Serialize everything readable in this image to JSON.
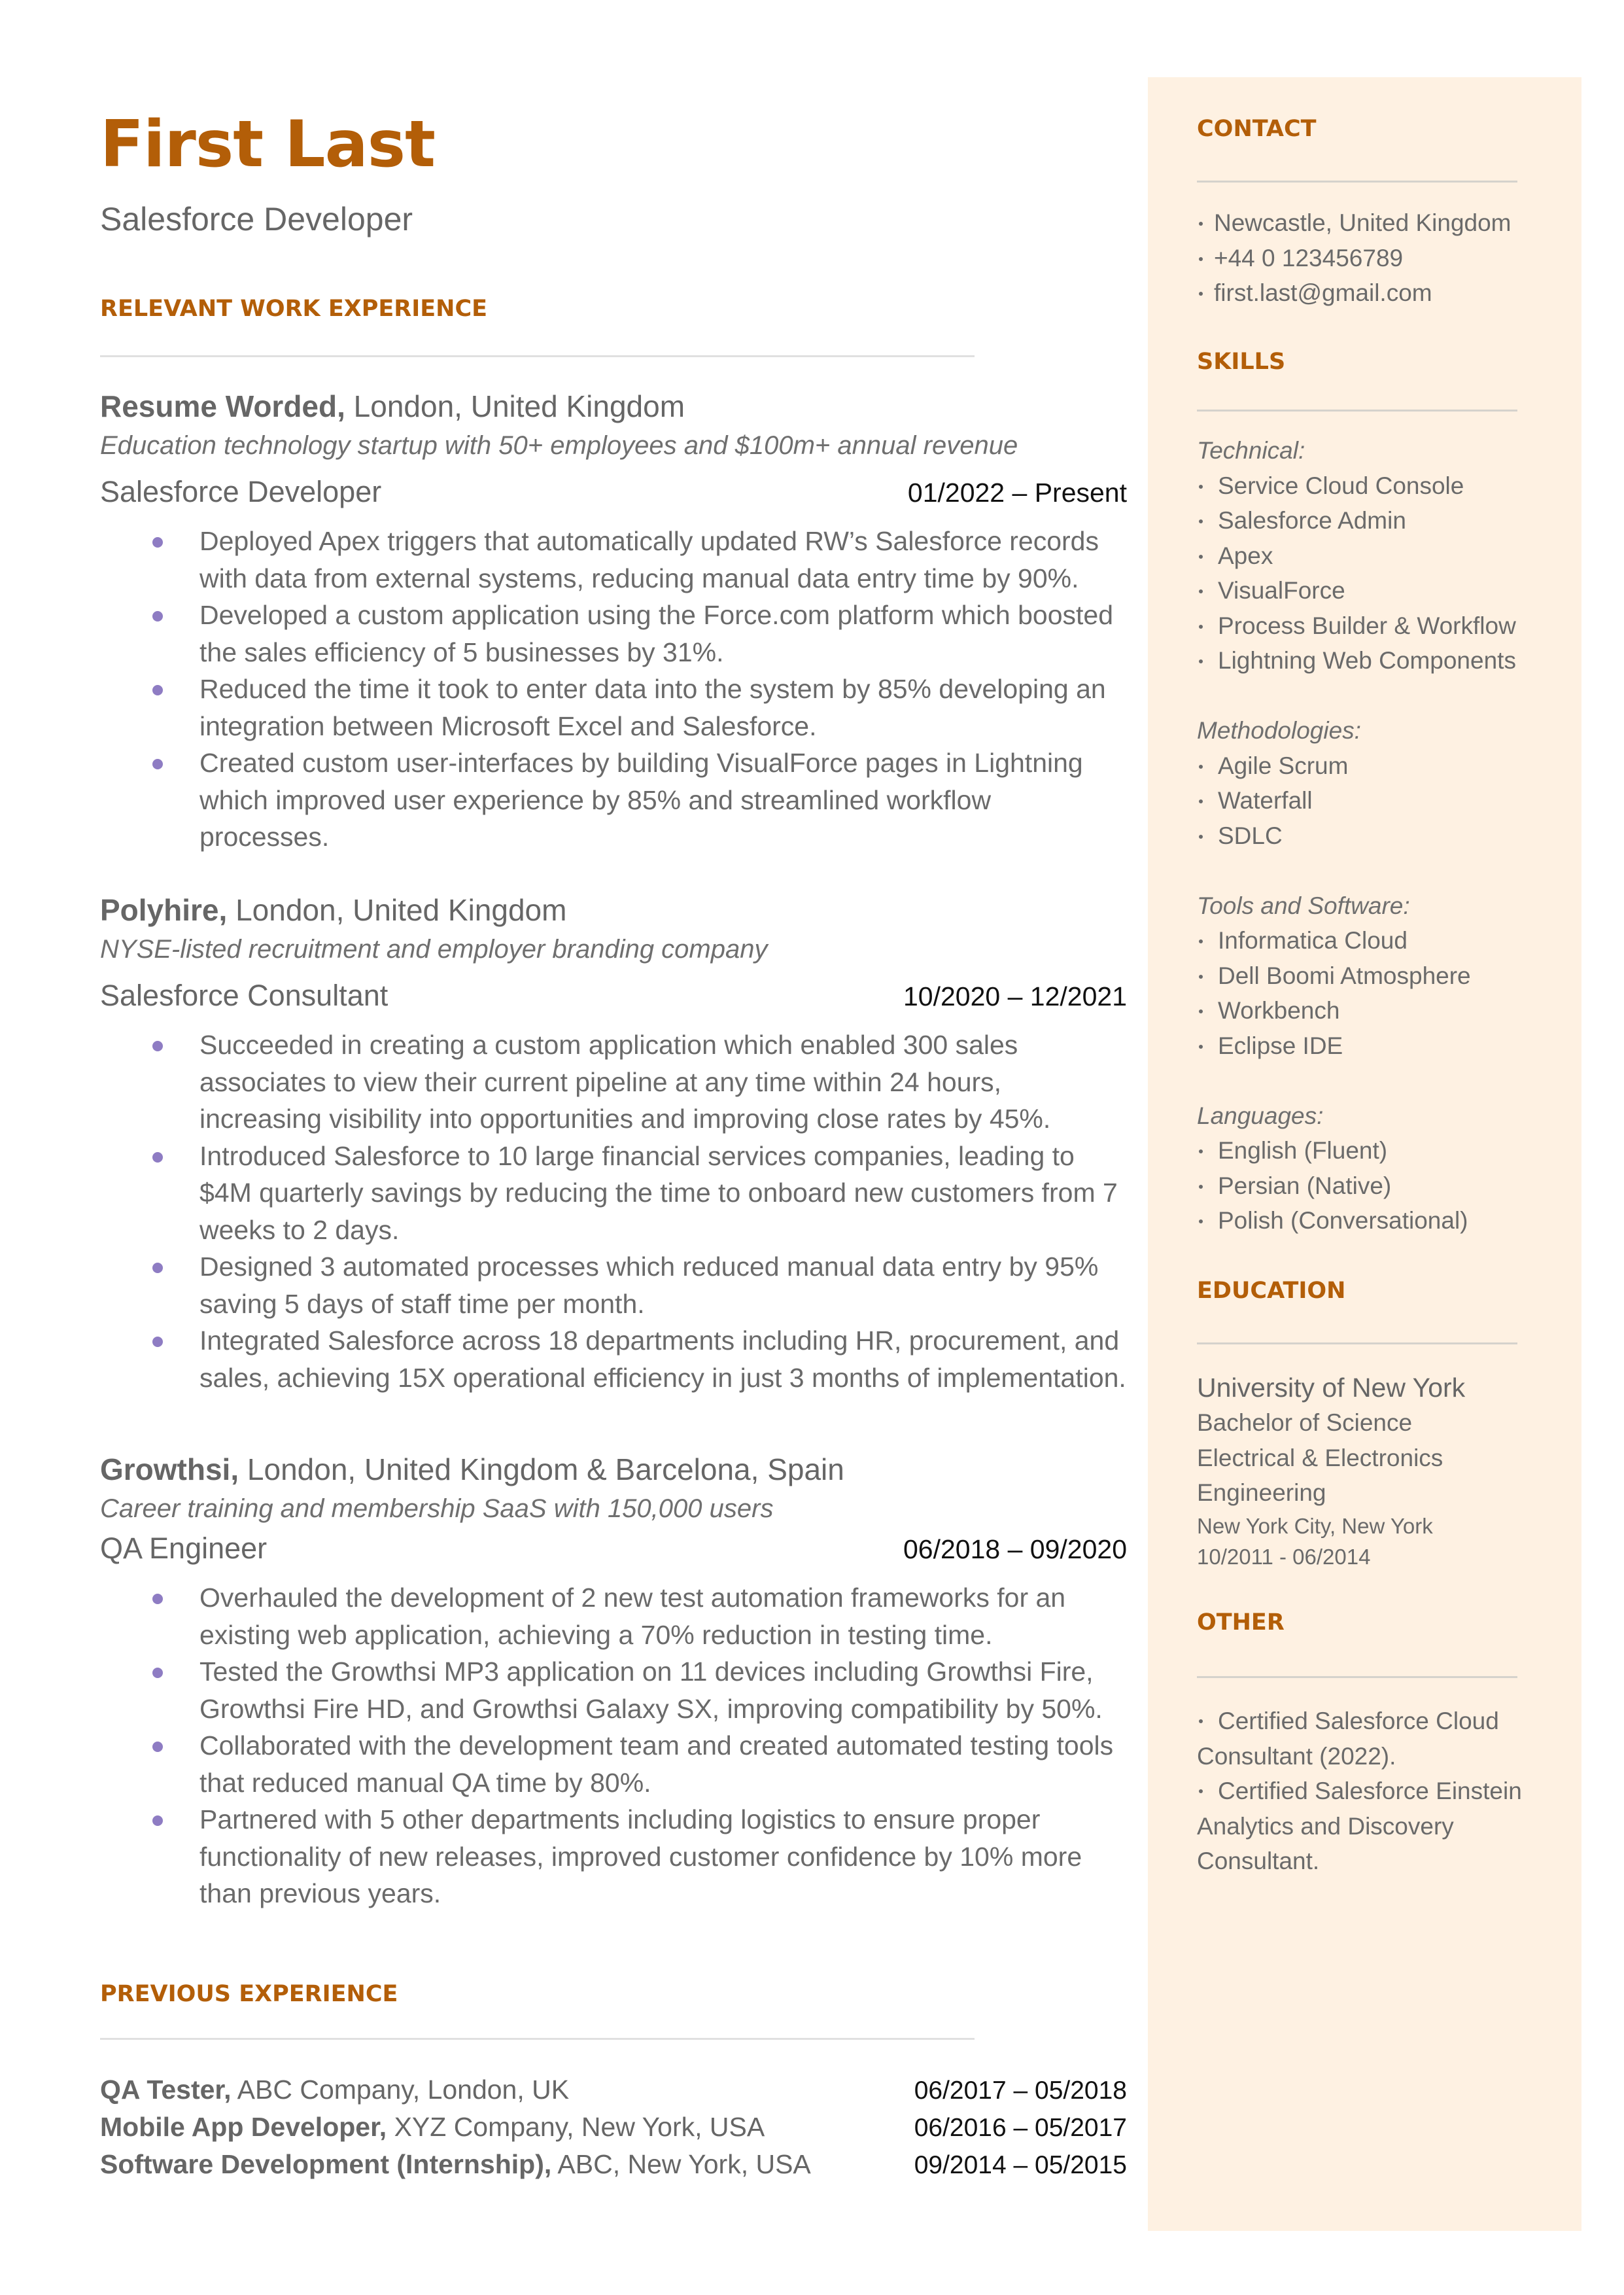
{
  "header": {
    "name": "First Last",
    "title": "Salesforce Developer"
  },
  "colors": {
    "accent": "#b35e08",
    "sidebar_bg": "#fef1e2",
    "bullet": "#8e7cc3",
    "text": "#666666",
    "dates": "#111111"
  },
  "work": {
    "heading": "RELEVANT WORK EXPERIENCE",
    "jobs": [
      {
        "company": "Resume Worded,",
        "location": " London, United Kingdom",
        "description": "Education technology startup with 50+ employees and $100m+ annual revenue",
        "role": "Salesforce Developer",
        "dates": "01/2022 – Present",
        "bullets": [
          "Deployed Apex triggers that automatically updated RW’s Salesforce records with data from external systems, reducing manual data entry time by 90%.",
          "Developed a custom application using the Force.com platform which boosted the sales efficiency of 5 businesses by 31%.",
          "Reduced the time it took to enter data into the system by 85% developing an integration between Microsoft Excel and Salesforce.",
          "Created custom user-interfaces by building VisualForce pages in Lightning which improved user experience by 85% and streamlined workflow processes."
        ]
      },
      {
        "company": "Polyhire,",
        "location": " London, United Kingdom",
        "description": "NYSE-listed recruitment and employer branding company",
        "role": "Salesforce Consultant",
        "dates": "10/2020 – 12/2021",
        "bullets": [
          "Succeeded in creating a custom application which enabled 300 sales associates to view their current pipeline at any time within 24 hours, increasing visibility into opportunities and improving close rates by 45%.",
          "Introduced Salesforce to 10 large financial services companies, leading to $4M quarterly savings by reducing the time to onboard new customers from 7 weeks to 2 days.",
          "Designed 3 automated processes which reduced manual data entry by 95% saving 5 days of staff time per month.",
          "Integrated Salesforce across 18 departments including HR, procurement, and sales, achieving 15X operational efficiency in just 3 months of implementation."
        ]
      },
      {
        "company": "Growthsi,",
        "location": " London, United Kingdom & Barcelona, Spain",
        "description": "Career training and membership SaaS with 150,000 users",
        "role": "QA Engineer",
        "dates": "06/2018 – 09/2020",
        "bullets": [
          "Overhauled the development of 2 new test automation frameworks for an existing web application, achieving a 70% reduction in testing time.",
          "Tested the Growthsi MP3 application on 11 devices including Growthsi Fire, Growthsi Fire HD, and Growthsi Galaxy SX, improving compatibility by 50%.",
          "Collaborated with the development team and created automated testing tools that reduced manual QA time by 80%.",
          "Partnered with 5 other departments including logistics to ensure proper functionality of new releases, improved customer confidence by 10% more than previous years."
        ]
      }
    ]
  },
  "previous": {
    "heading": "PREVIOUS EXPERIENCE",
    "items": [
      {
        "title": "QA Tester,",
        "detail": " ABC Company, London, UK",
        "dates": "06/2017 – 05/2018"
      },
      {
        "title": "Mobile App Developer,",
        "detail": " XYZ Company, New York, USA",
        "dates": "06/2016 – 05/2017"
      },
      {
        "title": "Software Development (Internship),",
        "detail": " ABC, New York, USA",
        "dates": "09/2014 – 05/2015"
      }
    ]
  },
  "sidebar": {
    "contact": {
      "heading": "CONTACT",
      "items": [
        "Newcastle, United Kingdom",
        "+44 0 123456789",
        "first.last@gmail.com"
      ]
    },
    "skills": {
      "heading": "SKILLS",
      "groups": [
        {
          "label": "Technical:",
          "items": [
            "Service Cloud Console",
            "Salesforce Admin",
            "Apex",
            "VisualForce",
            "Process Builder & Workflow",
            "Lightning Web Components"
          ]
        },
        {
          "label": "Methodologies:",
          "items": [
            "Agile Scrum",
            "Waterfall",
            "SDLC"
          ]
        },
        {
          "label": "Tools and Software:",
          "items": [
            "Informatica Cloud",
            "Dell Boomi Atmosphere",
            "Workbench",
            "Eclipse IDE"
          ]
        },
        {
          "label": "Languages:",
          "items": [
            "English (Fluent)",
            "Persian (Native)",
            "Polish (Conversational)"
          ]
        }
      ]
    },
    "education": {
      "heading": "EDUCATION",
      "school": "University of New York",
      "degree": "Bachelor of Science",
      "field_line1": "Electrical & Electronics",
      "field_line2": "Engineering",
      "location": "New York City, New York",
      "dates": "10/2011 - 06/2014"
    },
    "other": {
      "heading": "OTHER",
      "items": [
        "Certified Salesforce Cloud Consultant (2022).",
        "Certified Salesforce Einstein Analytics and Discovery Consultant."
      ]
    }
  }
}
